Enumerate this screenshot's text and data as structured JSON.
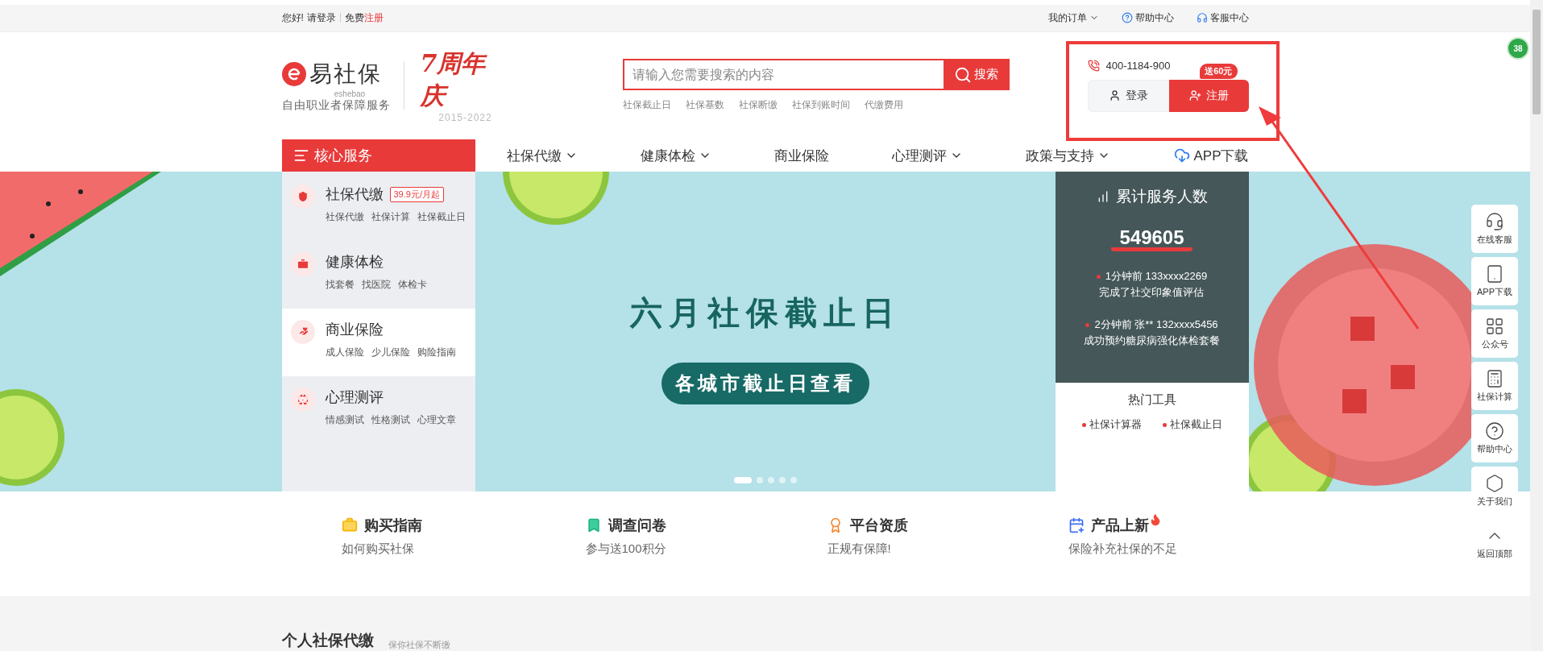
{
  "top_bar": {
    "greeting": "您好!",
    "login_link": "请登录",
    "register_prefix": "免费",
    "register_link": "注册",
    "links": [
      {
        "label": "我的订单",
        "kind": "dropdown"
      },
      {
        "label": "帮助中心",
        "kind": "help"
      },
      {
        "label": "客服中心",
        "kind": "service"
      }
    ]
  },
  "header": {
    "logo": {
      "name": "易社保",
      "sub": "eshebao",
      "slogan": "自由职业者保障服务"
    },
    "anniversary": {
      "title": "7周年庆",
      "years": "2015-2022"
    },
    "search": {
      "placeholder": "请输入您需要搜索的内容",
      "button": "搜索",
      "hot_words": [
        "社保截止日",
        "社保基数",
        "社保断缴",
        "社保到账时间",
        "代缴费用"
      ]
    },
    "account": {
      "phone": "400-1184-900",
      "promo": "送60元",
      "login": "登录",
      "register": "注册"
    }
  },
  "nav": {
    "core": "核心服务",
    "items": [
      {
        "label": "社保代缴",
        "dropdown": true
      },
      {
        "label": "健康体检",
        "dropdown": true
      },
      {
        "label": "商业保险",
        "dropdown": false
      },
      {
        "label": "心理测评",
        "dropdown": true
      },
      {
        "label": "政策与支持",
        "dropdown": true
      }
    ],
    "app": "APP下载"
  },
  "menu": [
    {
      "title": "社保代缴",
      "tag": "39.9元/月起",
      "kind": "shield",
      "selected": false,
      "links": [
        "社保代缴",
        "社保计算",
        "社保截止日"
      ]
    },
    {
      "title": "健康体检",
      "kind": "kit",
      "selected": false,
      "links": [
        "找套餐",
        "找医院",
        "体检卡"
      ]
    },
    {
      "title": "商业保险",
      "kind": "heart",
      "selected": true,
      "links": [
        "成人保险",
        "少儿保险",
        "购险指南"
      ]
    },
    {
      "title": "心理测评",
      "kind": "mind",
      "selected": false,
      "links": [
        "情感测试",
        "性格测试",
        "心理文章"
      ]
    }
  ],
  "banner": {
    "title": "六月社保截止日",
    "button": "各城市截止日查看",
    "dots": [
      {
        "selected": true
      },
      {
        "selected": false
      },
      {
        "selected": false
      },
      {
        "selected": false
      },
      {
        "selected": false
      }
    ]
  },
  "stats": {
    "title": "累计服务人数",
    "count": "549605",
    "feed": [
      {
        "line1": "1分钟前 133xxxx2269",
        "line2": "完成了社交印象值评估"
      },
      {
        "line1": "2分钟前 张** 132xxxx5456",
        "line2": "成功预约糖尿病强化体检套餐"
      }
    ],
    "tools_title": "热门工具",
    "tools": [
      "社保计算器",
      "社保截止日"
    ]
  },
  "side_tools": [
    {
      "label": "在线客服",
      "kind": "headset"
    },
    {
      "label": "APP下载",
      "kind": "tablet"
    },
    {
      "label": "公众号",
      "kind": "grid"
    },
    {
      "label": "社保计算",
      "kind": "calculator"
    },
    {
      "label": "帮助中心",
      "kind": "help"
    },
    {
      "label": "关于我们",
      "kind": "about"
    },
    {
      "label": "返回顶部",
      "kind": "top"
    }
  ],
  "features": [
    {
      "title": "购买指南",
      "subtitle": "如何购买社保",
      "kind": "bag",
      "hot": false
    },
    {
      "title": "调查问卷",
      "subtitle": "参与送100积分",
      "kind": "bookmark",
      "hot": false
    },
    {
      "title": "平台资质",
      "subtitle": "正规有保障!",
      "kind": "award",
      "hot": false
    },
    {
      "title": "产品上新",
      "subtitle": "保险补充社保的不足",
      "kind": "new",
      "hot": true
    }
  ],
  "section": {
    "title": "个人社保代缴",
    "subtitle": "保你社保不断缴"
  },
  "float_badge": "38"
}
